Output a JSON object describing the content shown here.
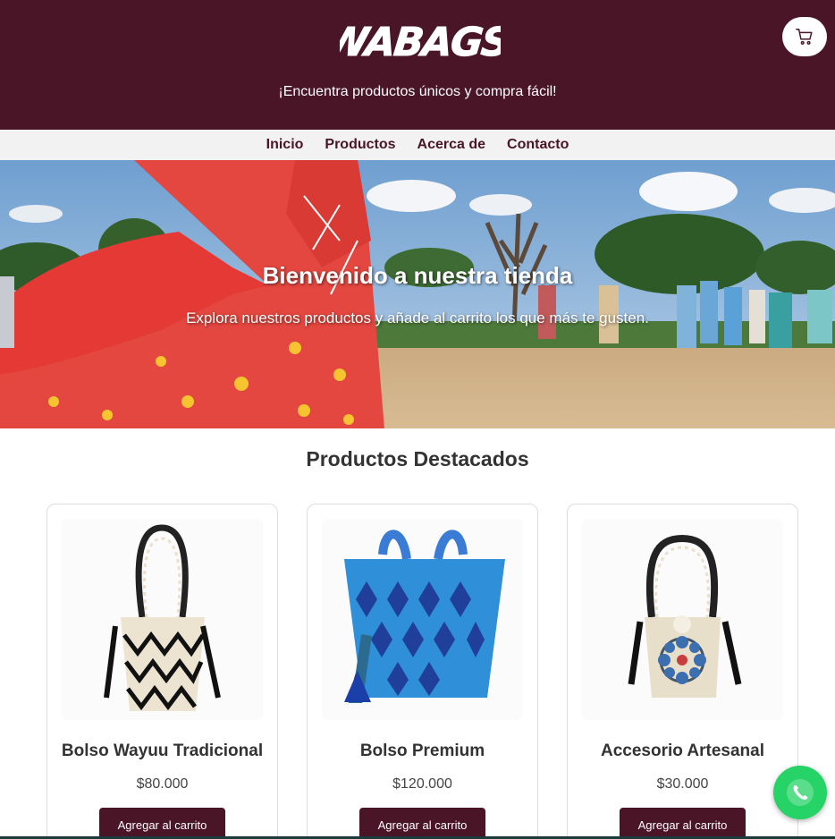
{
  "header": {
    "logo_text": "WABAGS",
    "tagline": "¡Encuentra productos únicos y compra fácil!",
    "cart_icon": "cart-icon",
    "brand_color": "#4a1526"
  },
  "nav": {
    "items": [
      {
        "label": "Inicio"
      },
      {
        "label": "Productos"
      },
      {
        "label": "Acerca de"
      },
      {
        "label": "Contacto"
      }
    ]
  },
  "hero": {
    "title": "Bienvenido a nuestra tienda",
    "subtitle": "Explora nuestros productos y añade al carrito los que más te gusten."
  },
  "featured": {
    "title": "Productos Destacados",
    "products": [
      {
        "name": "Bolso Wayuu Tradicional",
        "price": "$80.000",
        "button": "Agregar al carrito"
      },
      {
        "name": "Bolso Premium",
        "price": "$120.000",
        "button": "Agregar al carrito"
      },
      {
        "name": "Accesorio Artesanal",
        "price": "$30.000",
        "button": "Agregar al carrito"
      }
    ]
  },
  "floating": {
    "whatsapp_icon": "whatsapp-icon",
    "whatsapp_color": "#25d366"
  }
}
